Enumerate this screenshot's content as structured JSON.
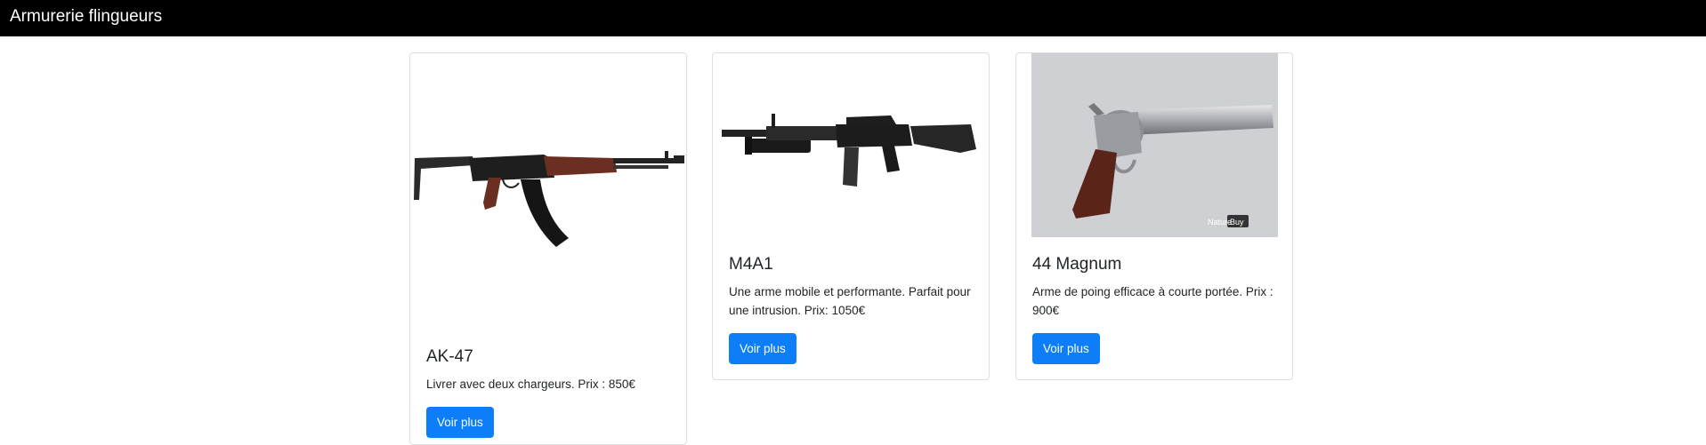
{
  "navbar": {
    "brand": "Armurerie flingueurs"
  },
  "colors": {
    "navbar_bg": "#000000",
    "button_bg": "#0d7ef8",
    "card_border": "#dfdfdf"
  },
  "products": [
    {
      "title": "AK-47",
      "description": "Livrer avec deux chargeurs. Prix : 850€",
      "button_label": "Voir plus",
      "image_icon": "rifle-image"
    },
    {
      "title": "M4A1",
      "description": "Une arme mobile et performante. Parfait pour une intrusion. Prix: 1050€",
      "button_label": "Voir plus",
      "image_icon": "assault-rifle-image"
    },
    {
      "title": "44 Magnum",
      "description": "Arme de poing efficace à courte portée. Prix : 900€",
      "button_label": "Voir plus",
      "image_icon": "revolver-image",
      "watermark": "NatureBuy"
    }
  ]
}
